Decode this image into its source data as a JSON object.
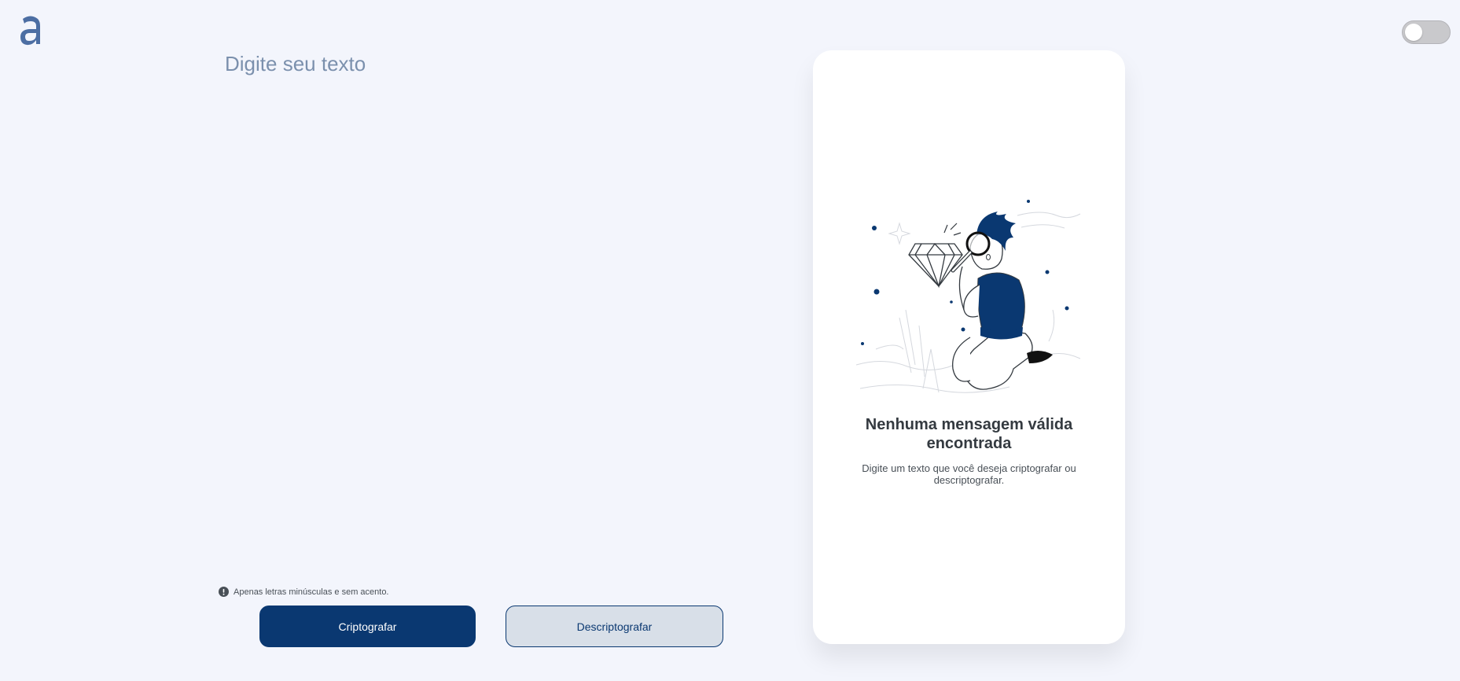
{
  "brand": {
    "logo_letter": "a",
    "color": "#0a3871"
  },
  "theme_toggle": {
    "state": "off"
  },
  "input": {
    "placeholder": "Digite seu texto",
    "value": ""
  },
  "hint": {
    "icon": "info-icon",
    "text": "Apenas letras minúsculas e sem acento."
  },
  "buttons": {
    "encrypt_label": "Criptografar",
    "decrypt_label": "Descriptografar"
  },
  "output": {
    "illustration": "person-with-magnifying-glass-and-diamond",
    "title": "Nenhuma mensagem válida encontrada",
    "description": "Digite um texto que você deseja criptografar ou descriptografar."
  },
  "colors": {
    "background": "#f3f5fc",
    "accent": "#0a3871",
    "secondary_button": "#d8dfe8",
    "card": "#ffffff"
  }
}
